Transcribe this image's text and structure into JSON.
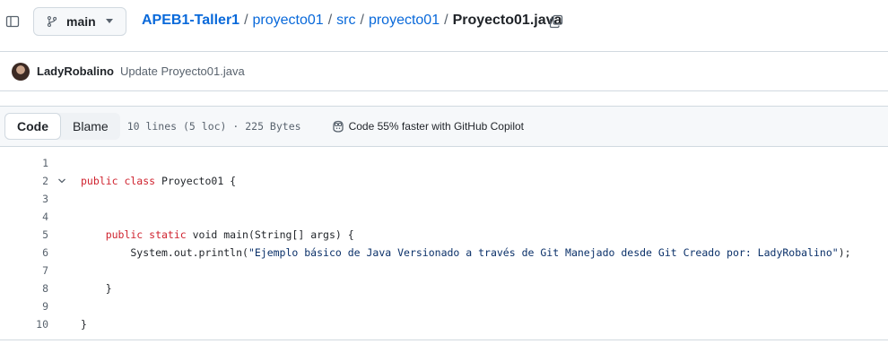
{
  "header": {
    "branch": "main",
    "breadcrumb": {
      "repo": "APEB1-Taller1",
      "path": [
        "proyecto01",
        "src",
        "proyecto01"
      ],
      "separator": "/",
      "file": "Proyecto01.java"
    }
  },
  "commit": {
    "author": "LadyRobalino",
    "message": "Update Proyecto01.java"
  },
  "file_header": {
    "tabs": [
      "Code",
      "Blame"
    ],
    "active_tab": "Code",
    "meta": "10 lines (5 loc) · 225 Bytes",
    "copilot_text": "Code 55% faster with GitHub Copilot"
  },
  "code": {
    "line_numbers": [
      "1",
      "2",
      "3",
      "4",
      "5",
      "6",
      "7",
      "8",
      "9",
      "10"
    ],
    "lines": [
      {
        "parts": []
      },
      {
        "parts": [
          {
            "t": "public class",
            "c": "kw"
          },
          {
            "t": " Proyecto01 {",
            "c": ""
          }
        ]
      },
      {
        "parts": []
      },
      {
        "parts": []
      },
      {
        "parts": [
          {
            "t": "    public static",
            "c": "kw"
          },
          {
            "t": " void ",
            "c": ""
          },
          {
            "t": "main",
            "c": ""
          },
          {
            "t": "(String[] args) {",
            "c": ""
          }
        ]
      },
      {
        "parts": [
          {
            "t": "        System.out.println(",
            "c": ""
          },
          {
            "t": "\"Ejemplo básico de Java Versionado a través de Git Manejado desde Git Creado por: LadyRobalino\"",
            "c": "str"
          },
          {
            "t": ");",
            "c": ""
          }
        ]
      },
      {
        "parts": []
      },
      {
        "parts": [
          {
            "t": "    }",
            "c": ""
          }
        ]
      },
      {
        "parts": []
      },
      {
        "parts": [
          {
            "t": "}",
            "c": ""
          }
        ]
      }
    ]
  },
  "icons": {
    "sidebar": "sidebar-toggle-icon",
    "branch": "git-branch-icon",
    "copy": "copy-icon",
    "copilot": "copilot-icon",
    "fold": "chevron-down-icon"
  },
  "colors": {
    "link": "#0969da",
    "keyword": "#cf222e",
    "string": "#0a3069"
  }
}
